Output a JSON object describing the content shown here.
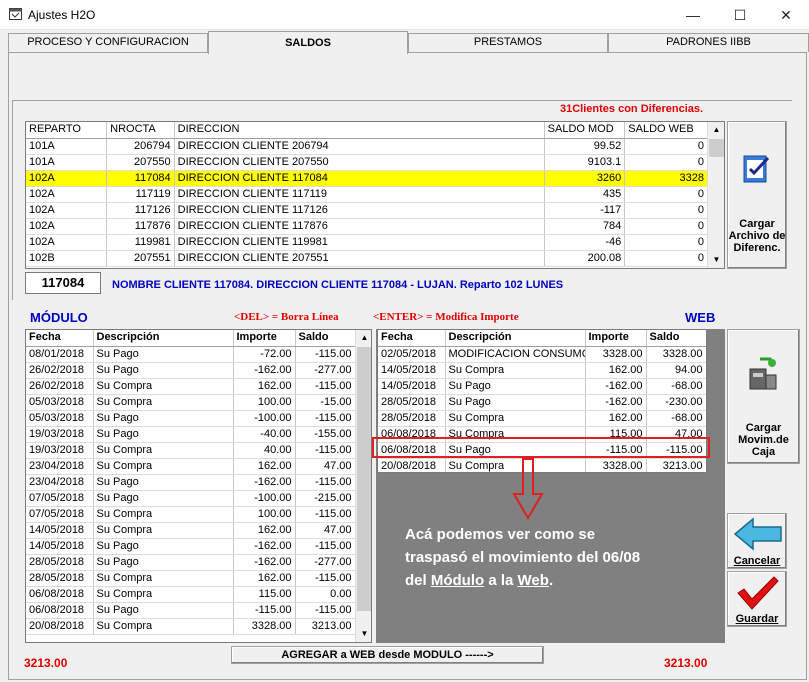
{
  "window": {
    "title": "Ajustes H2O",
    "minimize": "—",
    "maximize": "☐",
    "close": "✕"
  },
  "tabs": [
    {
      "label": "PROCESO Y CONFIGURACION"
    },
    {
      "label": "SALDOS"
    },
    {
      "label": "PRESTAMOS"
    },
    {
      "label": "PADRONES IIBB"
    }
  ],
  "clients_diff": "31Clientes con Diferencias.",
  "top_grid": {
    "headers": [
      "REPARTO",
      "NROCTA",
      "DIRECCION",
      "SALDO MOD",
      "SALDO WEB"
    ],
    "rows": [
      [
        "101A",
        "206794",
        "DIRECCION CLIENTE 206794",
        "99.52",
        "0"
      ],
      [
        "101A",
        "207550",
        "DIRECCION CLIENTE 207550",
        "9103.1",
        "0"
      ],
      [
        "102A",
        "117084",
        "DIRECCION CLIENTE 117084",
        "3260",
        "3328"
      ],
      [
        "102A",
        "117119",
        "DIRECCION CLIENTE 117119",
        "435",
        "0"
      ],
      [
        "102A",
        "117126",
        "DIRECCION CLIENTE 117126",
        "-117",
        "0"
      ],
      [
        "102A",
        "117876",
        "DIRECCION CLIENTE 117876",
        "784",
        "0"
      ],
      [
        "102A",
        "119981",
        "DIRECCION CLIENTE 119981",
        "-46",
        "0"
      ],
      [
        "102B",
        "207551",
        "DIRECCION CLIENTE 207551",
        "200.08",
        "0"
      ]
    ],
    "selected_index": 2
  },
  "account_field": "117084",
  "client_info": "NOMBRE CLIENTE 117084. DIRECCION CLIENTE 117084 - LUJAN. Reparto 102  LUNES",
  "btn_cargar_archivo": {
    "label": "Cargar Archivo de Diferenc.",
    "icon": "file-check-icon"
  },
  "modulo_label": "MÓDULO",
  "del_hint": "<DEL> = Borra Línea",
  "enter_hint": "<ENTER> = Modifica Importe",
  "web_label": "WEB",
  "modulo_grid": {
    "headers": [
      "Fecha",
      "Descripción",
      "Importe",
      "Saldo"
    ],
    "rows": [
      [
        "08/01/2018",
        "Su Pago",
        "-72.00",
        "-115.00"
      ],
      [
        "26/02/2018",
        "Su Pago",
        "-162.00",
        "-277.00"
      ],
      [
        "26/02/2018",
        "Su Compra",
        "162.00",
        "-115.00"
      ],
      [
        "05/03/2018",
        "Su Compra",
        "100.00",
        "-15.00"
      ],
      [
        "05/03/2018",
        "Su Pago",
        "-100.00",
        "-115.00"
      ],
      [
        "19/03/2018",
        "Su Pago",
        "-40.00",
        "-155.00"
      ],
      [
        "19/03/2018",
        "Su Compra",
        "40.00",
        "-115.00"
      ],
      [
        "23/04/2018",
        "Su Compra",
        "162.00",
        "47.00"
      ],
      [
        "23/04/2018",
        "Su Pago",
        "-162.00",
        "-115.00"
      ],
      [
        "07/05/2018",
        "Su Pago",
        "-100.00",
        "-215.00"
      ],
      [
        "07/05/2018",
        "Su Compra",
        "100.00",
        "-115.00"
      ],
      [
        "14/05/2018",
        "Su Compra",
        "162.00",
        "47.00"
      ],
      [
        "14/05/2018",
        "Su Pago",
        "-162.00",
        "-115.00"
      ],
      [
        "28/05/2018",
        "Su Pago",
        "-162.00",
        "-277.00"
      ],
      [
        "28/05/2018",
        "Su Compra",
        "162.00",
        "-115.00"
      ],
      [
        "06/08/2018",
        "Su Compra",
        "115.00",
        "0.00"
      ],
      [
        "06/08/2018",
        "Su Pago",
        "-115.00",
        "-115.00"
      ],
      [
        "20/08/2018",
        "Su Compra",
        "3328.00",
        "3213.00"
      ]
    ]
  },
  "web_grid": {
    "headers": [
      "Fecha",
      "Descripción",
      "Importe",
      "Saldo"
    ],
    "rows": [
      [
        "02/05/2018",
        "MODIFICACION CONSUMO",
        "3328.00",
        "3328.00"
      ],
      [
        "14/05/2018",
        "Su Compra",
        "162.00",
        "94.00"
      ],
      [
        "14/05/2018",
        "Su Pago",
        "-162.00",
        "-68.00"
      ],
      [
        "28/05/2018",
        "Su Pago",
        "-162.00",
        "-230.00"
      ],
      [
        "28/05/2018",
        "Su Compra",
        "162.00",
        "-68.00"
      ],
      [
        "06/08/2018",
        "Su Compra",
        "115.00",
        "47.00"
      ],
      [
        "06/08/2018",
        "Su Pago",
        "-115.00",
        "-115.00"
      ],
      [
        "20/08/2018",
        "Su Compra",
        "3328.00",
        "3213.00"
      ]
    ]
  },
  "btn_cargar_movim": {
    "label": "Cargar Movim.de Caja",
    "icon": "cash-register-icon"
  },
  "note": {
    "l1": "Acá podemos ver como se",
    "l2": "traspasó el movimiento del 06/08",
    "l3a": "del ",
    "l3b": "Módulo",
    "l3c": " a la ",
    "l3d": "Web",
    "l3e": "."
  },
  "btn_cancelar": {
    "label": "Cancelar",
    "icon": "back-arrow-icon"
  },
  "btn_guardar": {
    "label": "Guardar",
    "icon": "checkmark-icon"
  },
  "btn_agregar": "AGREGAR a WEB desde MODULO ------>",
  "total_modulo": "3213.00",
  "total_web": "3213.00",
  "colors": {
    "highlight": "#ffff00",
    "red": "#e00000",
    "blue": "#0000c0",
    "gray_area": "#808080",
    "callout": "#e02020"
  }
}
